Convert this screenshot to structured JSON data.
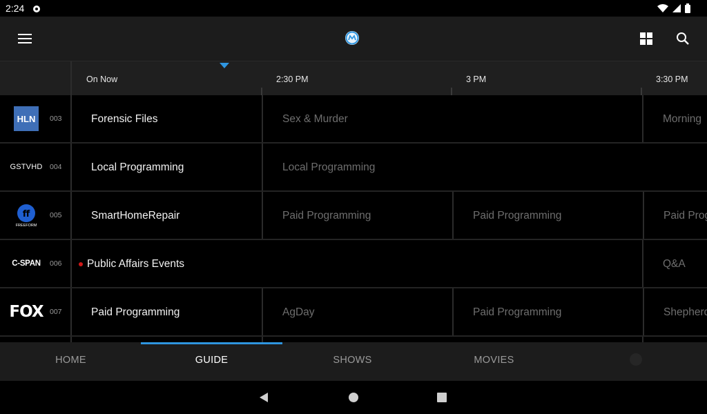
{
  "status_bar": {
    "time": "2:24"
  },
  "header": {
    "menu_icon": "menu-icon",
    "logo_icon": "app-logo-icon",
    "grid_icon": "grid-icon",
    "search_icon": "search-icon"
  },
  "timeline": {
    "on_now": "On Now",
    "slot_1": "2:30 PM",
    "slot_2": "3 PM",
    "slot_3": "3:30 PM"
  },
  "channels": [
    {
      "logo": "HLN",
      "number": "003",
      "programs": [
        "Forensic Files",
        "Sex & Murder",
        "Morning"
      ]
    },
    {
      "logo": "GSTVHD",
      "number": "004",
      "programs": [
        "Local Programming",
        "Local Programming"
      ]
    },
    {
      "logo": "FREEFORM",
      "number": "005",
      "programs": [
        "SmartHomeRepair",
        "Paid Programming",
        "Paid Programming",
        "Paid Prog"
      ]
    },
    {
      "logo": "C-SPAN",
      "number": "006",
      "programs": [
        "Public Affairs Events",
        "Q&A"
      ]
    },
    {
      "logo": "FOX",
      "number": "007",
      "programs": [
        "Paid Programming",
        "AgDay",
        "Paid Programming",
        "Shepherd"
      ]
    }
  ],
  "bottom_nav": {
    "home": "HOME",
    "guide": "GUIDE",
    "shows": "SHOWS",
    "movies": "MOVIES",
    "active": "GUIDE"
  },
  "colors": {
    "accent": "#2f96e0",
    "live": "#d01818"
  }
}
